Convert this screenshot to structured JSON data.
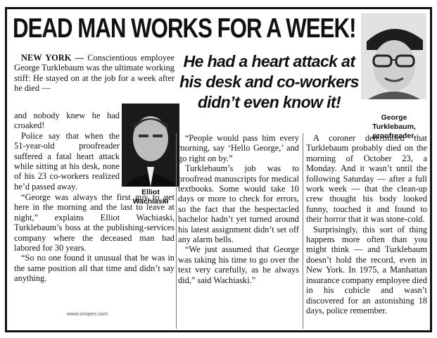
{
  "headline": "DEAD MAN WORKS FOR A WEEK!",
  "deck": [
    "He had a heart attack at",
    "his desk and co-workers",
    "didn’t even know it!"
  ],
  "captions": {
    "george": [
      "George",
      "Turklebaum,",
      "proofreader."
    ],
    "elliot": [
      "Elliot",
      "Wachiaski"
    ]
  },
  "credit": "www.snopes.com",
  "article": {
    "dateline": "NEW YORK —",
    "p1a": "Conscientious employee George Turklebaum was the ultimate working stiff: He stayed on at the job for a week after he died —",
    "p1b": "and nobody knew he had croaked!",
    "p2": "Police say that when the 51-year-old proofreader suffered a fatal heart attack while sitting at his desk, none of his 23 co-workers realized he’d passed away.",
    "p3": "“George was always the first guy to get here in the morning and the last to leave at night,” explains Elliot Wachiaski, Turklebaum’s boss at the publishing-services company where the deceased man had labored for 30 years.",
    "p4": "“So no one found it unusual that he was in the same position all that time and didn’t say anything.",
    "p5": "“People would pass him every morning, say ‘Hello George,’ and go right on by.”",
    "p6": "Turklebaum’s job was to proofread manuscripts for medical textbooks. Some would take 10 days or more to check for errors, so the fact that the bespectacled bachelor hadn’t yet turned around his latest assignment didn’t set off any alarm bells.",
    "p7": "“We just assumed that George was taking his time to go over the text very carefully, as he always did,” said Wachiaski.”",
    "p8": "A coroner determined that Turklebaum probably died on the morning of October 23, a Monday. And it wasn’t until the following Saturday — after a full work week — that the clean-up crew thought his body looked funny, touched it and found to their horror that it was stone-cold.",
    "p9": "Surprisingly, this sort of thing happens more often than you might think — and Turklebaum doesn’t hold the record, even in New York. In 1975, a Manhattan insurance company employee died in his cubicle and wasn’t discovered for an astonishing 18 days, police remember."
  }
}
